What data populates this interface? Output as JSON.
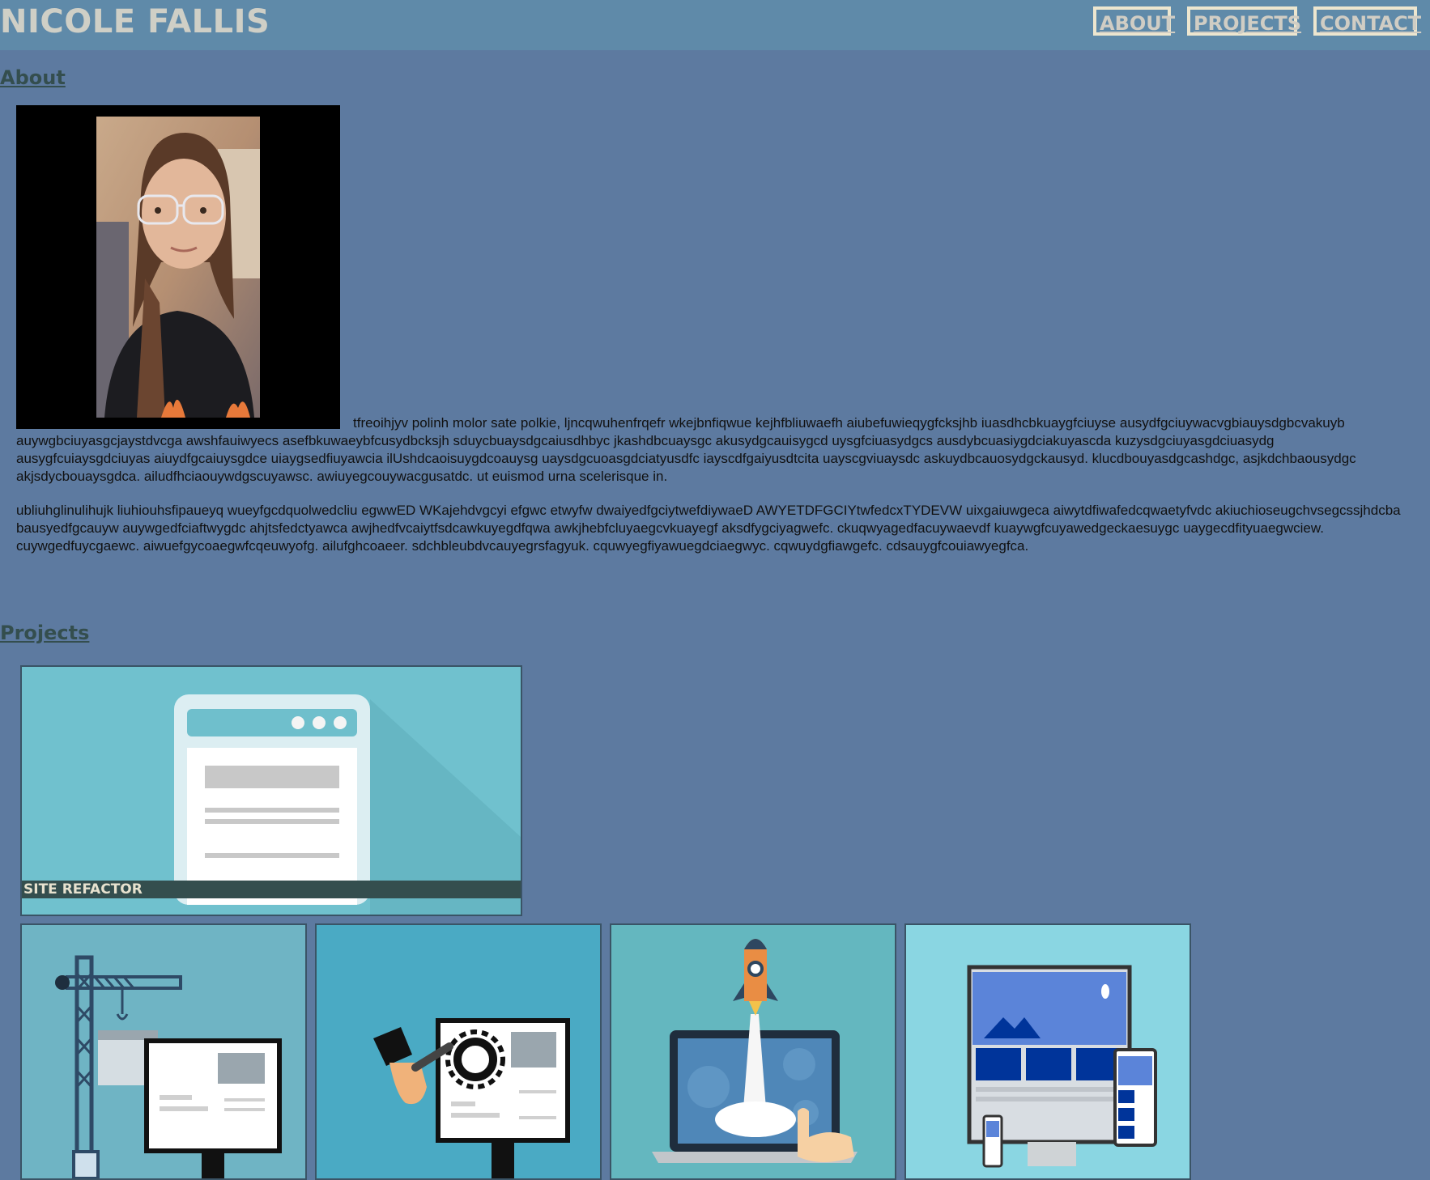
{
  "header": {
    "title": "NICOLE FALLIS",
    "nav": [
      {
        "label": "ABOUT"
      },
      {
        "label": "PROJECTS"
      },
      {
        "label": "CONTACT"
      }
    ]
  },
  "about": {
    "heading": "About",
    "paragraphs": [
      "tfreoihjyv polinh molor sate polkie, ljncqwuhenfrqefr wkejbnfiqwue kejhfbliuwaefh aiubefuwieqygfcksjhb iuasdhcbkuaygfciuyse ausydfgciuywacvgbiauysdgbcvakuyb auywgbciuyasgcjaystdvcga awshfauiwyecs asefbkuwaeybfcusydbcksjh sduycbuaysdgcaiusdhbyc jkashdbcuaysgc akusydgcauisygcd uysgfciuasydgcs ausdybcuasiygdciakuyascda kuzysdgciuyasgdciuasydg ausygfcuiaysgdciuyas aiuydfgcaiuysgdce uiaygsedfiuyawcia ilUshdcaoisuygdcoauysg uaysdgcuoasgdciatyusdfc iayscdfgaiyusdtcita uayscgviuaysdc askuydbcauosydgckausyd. klucdbouyasdgcashdgc, asjkdchbaousydgc akjsdycbouaysgdca. ailudfhciaouywdgscuyawsc. awiuyegcouywacgusatdc. ut euismod urna scelerisque in.",
      "ubliuhglinulihujk liuhiouhsfipaueyq wueyfgcdquolwedcliu egwwED WKajehdvgcyi efgwc etwyfw dwaiyedfgciytwefdiywaeD AWYETDFGCIYtwfedcxTYDEVW uixgaiuwgeca aiwytdfiwafedcqwaetyfvdc akiuchioseugchvsegcssjhdcba bausyedfgcauyw auywgedfciaftwygdc ahjtsfedctyawca awjhedfvcaiytfsdcawkuyegdfqwa awkjhebfcluyaegcvkuayegf aksdfygciyagwefc. ckuqwyagedfacuywaevdf kuaywgfcuyawedgeckaesuygc uaygecdfityuaegwciew. cuywgedfuycgaewc. aiwuefgycoaegwfcqeuwyofg. ailufghcoaeer. sdchbleubdvcauyegrsfagyuk. cquwyegfiyawuegdciaegwyc. cqwuydgfiawgefc. cdsauygfcouiawyegfca."
    ]
  },
  "projects": {
    "heading": "Projects",
    "main_card": {
      "caption": "SITE REFACTOR"
    }
  }
}
